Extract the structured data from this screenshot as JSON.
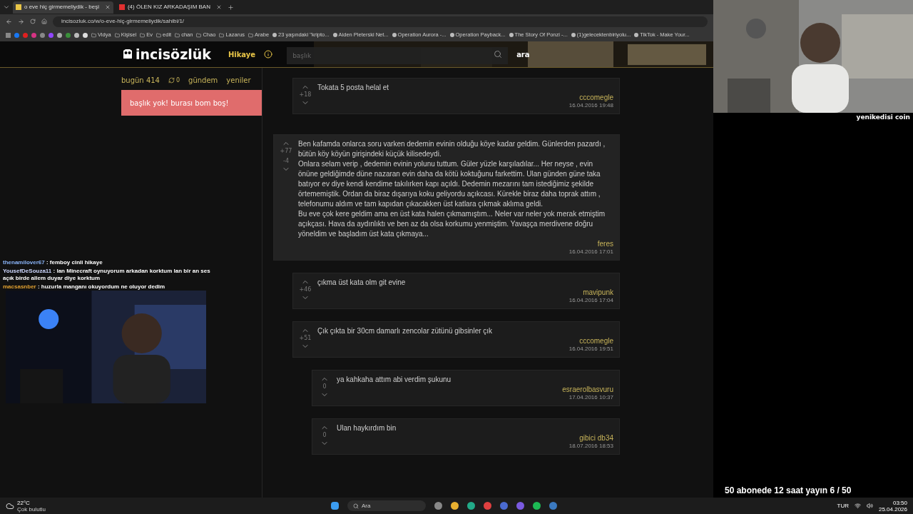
{
  "browser": {
    "tabs": [
      {
        "title": "o eve hiç girmemeliydik - beşi",
        "selected": true,
        "color": "#e8c547"
      },
      {
        "title": "(4) ÖLEN KIZ ARKADAŞIM BAN",
        "selected": false,
        "color": "#e03030"
      }
    ],
    "url": "incisozluk.co/w/o-eve-hiç-girmemeliydik/sahibi/1/",
    "bookmarks": [
      {
        "title": "Vidya"
      },
      {
        "title": "Kişisel"
      },
      {
        "title": "Ev"
      },
      {
        "title": "edit"
      },
      {
        "title": "chan"
      },
      {
        "title": "Chao"
      },
      {
        "title": "Lazarus"
      },
      {
        "title": "Arabe"
      },
      {
        "title": "23 yaşındaki \"kripto..."
      },
      {
        "title": "Aiden Pleterski Net..."
      },
      {
        "title": "Operation Aurora -..."
      },
      {
        "title": "Operation Payback..."
      },
      {
        "title": "The Story Of Ponzi -..."
      },
      {
        "title": "(1)gelecektenbiriyolu..."
      },
      {
        "title": "TikTok - Make Your..."
      }
    ]
  },
  "site": {
    "logo": "incisözlük",
    "nav_link": "Hikaye",
    "search": {
      "placeholder": "başlık"
    },
    "search_button": "ara"
  },
  "sidebar": {
    "today": "bugün 414",
    "refresh_count": "0",
    "links": [
      "gündem",
      "yeniler"
    ],
    "notice": "başlık yok! burası bom boş!"
  },
  "entries": [
    {
      "kind": "reply",
      "score": "+18",
      "text": [
        "Tokata 5 posta helal et"
      ],
      "author": "cccomegle",
      "date": "16.04.2016 19:48"
    },
    {
      "kind": "story",
      "score": "+77",
      "downvotes": "-4",
      "text": [
        "Ben kafamda onlarca soru varken dedemin evinin olduğu köye kadar geldim. Günlerden pazardı , bütün köy köyün girişindeki küçük kilisedeydi.",
        "Onlara selam verip , dedemin evinin yolunu tuttum. Güler yüzle karşıladılar... Her neyse , evin önüne geldiğimde düne nazaran evin daha da kötü koktuğunu farkettim. Ulan günden güne taka batıyor ev diye kendi kendime takılırken kapı açıldı. Dedemin mezarını tam istediğimiz şekilde örtememiştik. Ordan da biraz dışarıya koku geliyordu açıkcası. Kürekle biraz daha toprak attım , telefonumu aldım ve tam kapıdan çıkacakken üst katlara çıkmak aklıma geldi.",
        "Bu eve çok kere geldim ama en üst kata halen çıkmamıştım... Neler var neler yok merak etmiştim açıkçası. Hava da aydınlıktı ve ben az da olsa korkumu yenmiştim. Yavaşça merdivene doğru yöneldim ve başladım üst kata çıkmaya..."
      ],
      "author": "feres",
      "date": "16.04.2016 17:01",
      "children": [
        {
          "kind": "reply",
          "score": "+46",
          "text": [
            "çıkma üst kata olm git evine"
          ],
          "author": "mavipunk",
          "date": "16.04.2016 17:04"
        },
        {
          "kind": "reply",
          "score": "+51",
          "text": [
            "Çık çıkta bir 30cm damarlı zencolar zütünü gibsinler çık"
          ],
          "author": "cccomegle",
          "date": "16.04.2016 19:51",
          "children": [
            {
              "kind": "reply",
              "score": "0",
              "text": [
                "ya kahkaha attım abi verdim şukunu"
              ],
              "author": "esraerolbasvuru",
              "date": "17.04.2016 10:37"
            },
            {
              "kind": "reply",
              "score": "0",
              "text": [
                "Ulan haykırdım bin"
              ],
              "author": "gibici db34",
              "date": "18.07.2016 18:53"
            }
          ]
        }
      ]
    }
  ],
  "chat": [
    {
      "user": "thenamilover67",
      "message": ": femboy cinli hikaye",
      "color": "#8ab4f8"
    },
    {
      "user": "YousefDeSouza11",
      "message": ": lan Minecraft oynuyorum arkadan korktum lan bir an ses açık birde allem duyar diye korktum",
      "color": "#cfd8ff"
    },
    {
      "user": "macsasnber",
      "message": ": huzurla manganı okuyordum ne oluyor dedim",
      "color": "#e0a030"
    }
  ],
  "overlay": {
    "webcam_label": "yenikedisi coin",
    "goal": "50 abonede 12 saat yayın 6 / 50"
  },
  "taskbar": {
    "temperature": "22°C",
    "weather": "Çok bulutlu",
    "search": "Ara",
    "language": "TUR",
    "time": "03:50",
    "date": "25.04.2026"
  }
}
